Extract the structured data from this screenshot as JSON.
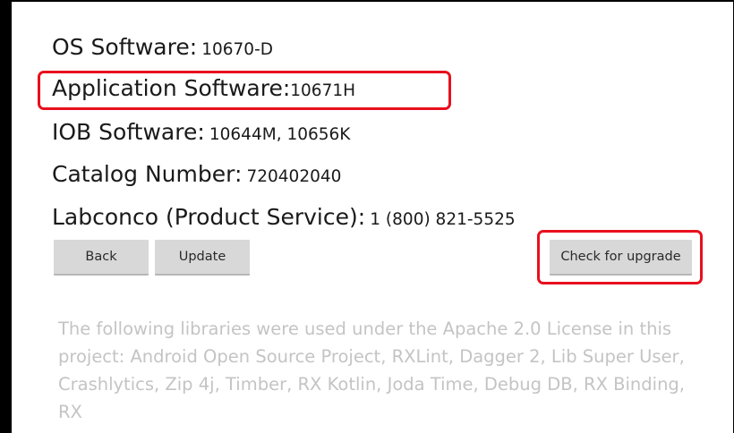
{
  "about": {
    "os_software": {
      "label": "OS Software:",
      "value": "10670-D"
    },
    "application_software": {
      "label": "Application Software:",
      "value": "10671H"
    },
    "iob_software": {
      "label": "IOB Software:",
      "value": "10644M, 10656K"
    },
    "catalog_number": {
      "label": "Catalog Number:",
      "value": "720402040"
    },
    "product_service": {
      "label": "Labconco (Product Service):",
      "value": "1 (800) 821-5525"
    }
  },
  "buttons": {
    "back": "Back",
    "update": "Update",
    "check_upgrade": "Check for upgrade"
  },
  "license": {
    "text": "The following libraries were used under the Apache 2.0 License in this project: Android Open Source Project, RXLint, Dagger 2, Lib Super User, Crashlytics, Zip 4j, Timber, RX Kotlin, Joda Time, Debug DB, RX Binding, RX"
  },
  "colors": {
    "highlight": "#e8101e",
    "button_bg": "#d8d8d8",
    "license_text": "#c4c4c4",
    "background": "#ffffff"
  }
}
